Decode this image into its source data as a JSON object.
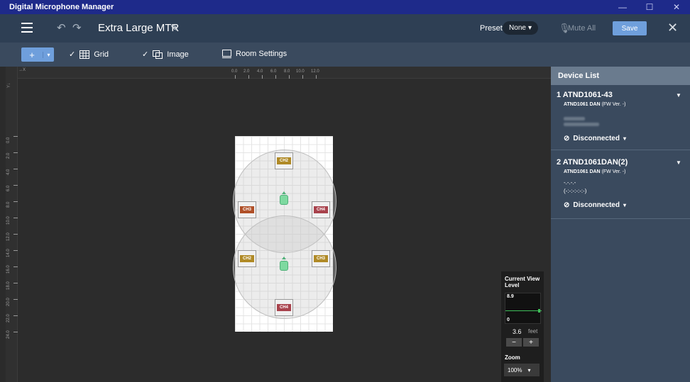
{
  "window": {
    "title": "Digital Microphone Manager",
    "controls": {
      "minimize": "—",
      "maximize": "☐",
      "close": "✕"
    }
  },
  "header": {
    "menu_icon": "hamburger-icon",
    "undo_icon": "undo-icon",
    "redo_icon": "redo-icon",
    "room_name": "Extra Large MTR",
    "edit_icon": "pencil-icon",
    "preset_label": "Preset",
    "preset_value": "None",
    "mute_all_label": "Mute All",
    "save_label": "Save",
    "close_label": "✕"
  },
  "toolbar": {
    "add_label": "+",
    "grid_label": "Grid",
    "grid_checked": true,
    "image_label": "Image",
    "image_checked": true,
    "room_settings_label": "Room Settings"
  },
  "ruler": {
    "corner_top": "→X",
    "corner_left": "Y↓",
    "top_ticks": [
      "0.0",
      "2.0",
      "4.0",
      "6.0",
      "8.0",
      "10.0",
      "12.0"
    ],
    "left_ticks": [
      "0.0",
      "2.0",
      "4.0",
      "6.0",
      "8.0",
      "10.0",
      "12.0",
      "14.0",
      "16.0",
      "18.0",
      "20.0",
      "22.0",
      "24.0"
    ]
  },
  "room": {
    "mics": [
      {
        "channels": [
          "CH2",
          "CH3",
          "CH4"
        ]
      },
      {
        "channels": [
          "CH2",
          "CH3",
          "CH4"
        ]
      }
    ]
  },
  "view_panel": {
    "title": "Current View Level",
    "max": "8.9",
    "min": "0",
    "value": "3.6",
    "unit": "feet",
    "minus": "−",
    "plus": "+",
    "zoom_label": "Zoom",
    "zoom_value": "100%"
  },
  "device_list": {
    "title": "Device List",
    "devices": [
      {
        "name": "1 ATND1061-43",
        "model": "ATND1061 DAN",
        "fw": "(FW Ver. -)",
        "status": "Disconnected"
      },
      {
        "name": "2 ATND1061DAN(2)",
        "model": "ATND1061 DAN",
        "fw": "(FW Ver. -)",
        "line1": "-.-.-.-",
        "line2": "(-:-:-:-:-:-)",
        "status": "Disconnected"
      }
    ]
  }
}
